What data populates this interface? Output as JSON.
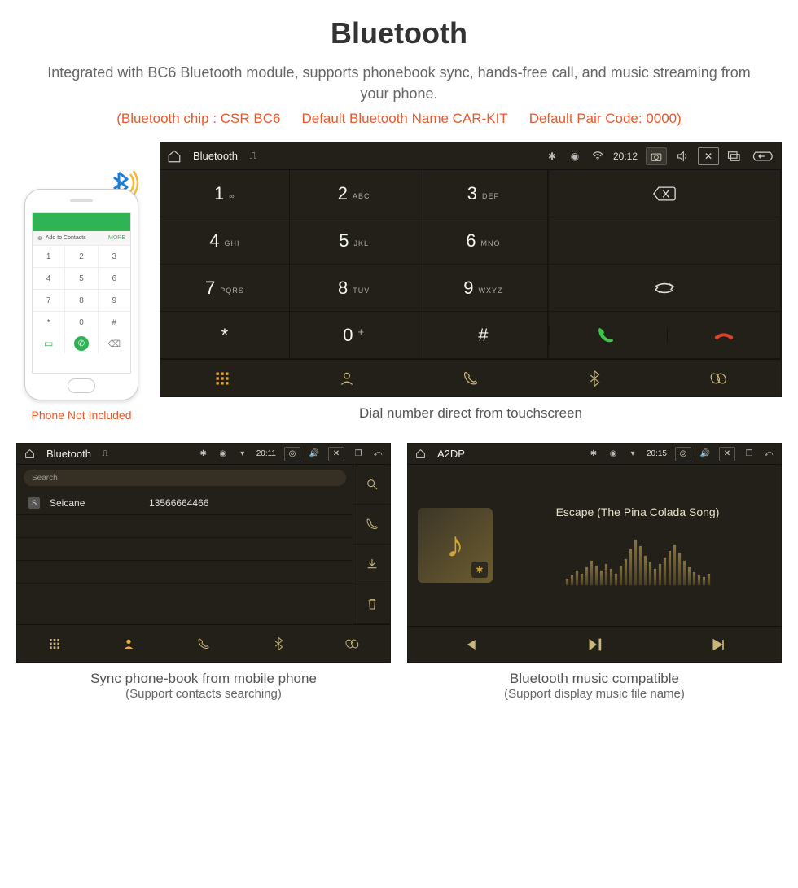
{
  "title": "Bluetooth",
  "subtitle": "Integrated with BC6 Bluetooth module, supports phonebook sync, hands-free call, and music streaming from your phone.",
  "specs": {
    "chip": "(Bluetooth chip : CSR BC6",
    "name": "Default Bluetooth Name CAR-KIT",
    "code": "Default Pair Code: 0000)"
  },
  "phone": {
    "topbar": "",
    "addLabel": "Add to Contacts",
    "moreLabel": "MORE",
    "keys": [
      "1",
      "2",
      "3",
      "4",
      "5",
      "6",
      "7",
      "8",
      "9",
      "*",
      "0",
      "#"
    ],
    "caption": "Phone Not Included"
  },
  "dialer": {
    "headerTitle": "Bluetooth",
    "time": "20:12",
    "keys": [
      {
        "n": "1",
        "s": "∞"
      },
      {
        "n": "2",
        "s": "ABC"
      },
      {
        "n": "3",
        "s": "DEF"
      },
      {
        "n": "4",
        "s": "GHI"
      },
      {
        "n": "5",
        "s": "JKL"
      },
      {
        "n": "6",
        "s": "MNO"
      },
      {
        "n": "7",
        "s": "PQRS"
      },
      {
        "n": "8",
        "s": "TUV"
      },
      {
        "n": "9",
        "s": "WXYZ"
      },
      {
        "n": "*",
        "s": ""
      },
      {
        "n": "0",
        "s": "+",
        "sup": true
      },
      {
        "n": "#",
        "s": ""
      }
    ],
    "caption": "Dial number direct from touchscreen"
  },
  "phonebook": {
    "headerTitle": "Bluetooth",
    "time": "20:11",
    "searchPlaceholder": "Search",
    "entries": [
      {
        "badge": "S",
        "name": "Seicane",
        "number": "13566664466"
      }
    ],
    "caption": "Sync phone-book from mobile phone",
    "captionSub": "(Support contacts searching)"
  },
  "music": {
    "headerTitle": "A2DP",
    "time": "20:15",
    "track": "Escape (The Pina Colada Song)",
    "caption": "Bluetooth music compatible",
    "captionSub": "(Support display music file name)"
  },
  "viz_heights": [
    8,
    12,
    18,
    14,
    22,
    30,
    24,
    18,
    26,
    20,
    14,
    24,
    32,
    44,
    56,
    48,
    36,
    28,
    20,
    26,
    34,
    42,
    50,
    40,
    30,
    22,
    16,
    12,
    10,
    14
  ]
}
